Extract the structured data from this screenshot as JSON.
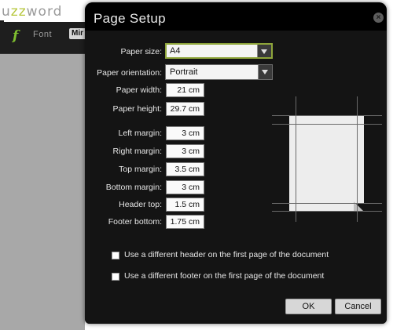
{
  "app": {
    "title_prefix": "u",
    "title_accent": "zz",
    "title_suffix": "word",
    "font_label": "Font",
    "mini_button_label": "Mir",
    "font_icon_glyph": "f"
  },
  "dialog": {
    "title": "Page Setup",
    "close_glyph": "×",
    "fields": {
      "paper_size": {
        "label": "Paper size:",
        "value": "A4"
      },
      "paper_orientation": {
        "label": "Paper orientation:",
        "value": "Portrait"
      },
      "paper_width": {
        "label": "Paper width:",
        "value": "21 cm"
      },
      "paper_height": {
        "label": "Paper height:",
        "value": "29.7 cm"
      },
      "left_margin": {
        "label": "Left margin:",
        "value": "3 cm"
      },
      "right_margin": {
        "label": "Right margin:",
        "value": "3 cm"
      },
      "top_margin": {
        "label": "Top margin:",
        "value": "3.5 cm"
      },
      "bottom_margin": {
        "label": "Bottom margin:",
        "value": "3 cm"
      },
      "header_top": {
        "label": "Header top:",
        "value": "1.5 cm"
      },
      "footer_bottom": {
        "label": "Footer bottom:",
        "value": "1.75 cm"
      }
    },
    "checkboxes": {
      "diff_header": {
        "label": "Use a different header on the first page of the document",
        "checked": false
      },
      "diff_footer": {
        "label": "Use a different footer on the first page of the document",
        "checked": false
      }
    },
    "buttons": {
      "ok": "OK",
      "cancel": "Cancel"
    }
  },
  "colors": {
    "accent": "#8ea53a",
    "dialog_bg": "#141414",
    "titlebar_bg": "#000000",
    "brand_green": "#b6c63a"
  }
}
